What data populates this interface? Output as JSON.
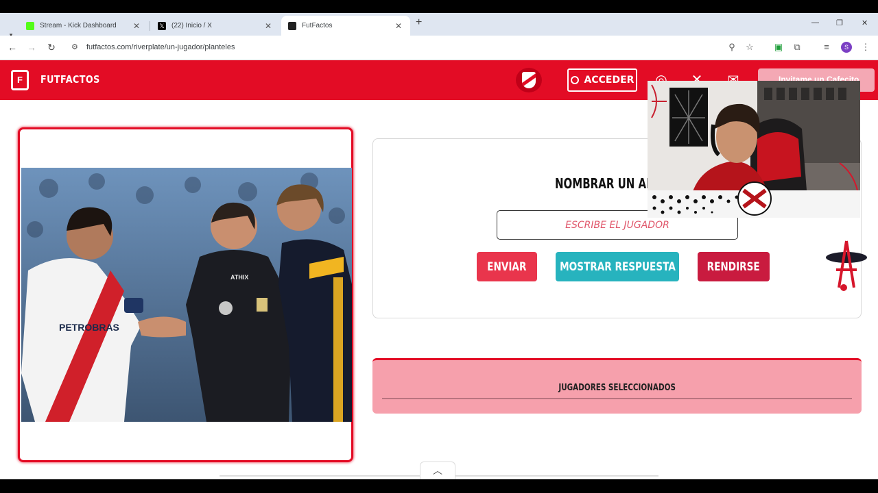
{
  "browser": {
    "tabs": [
      {
        "title": "Stream - Kick Dashboard",
        "favicon": "kick-icon",
        "color": "#53fc18",
        "active": false
      },
      {
        "title": "(22) Inicio / X",
        "favicon": "x-icon",
        "color": "#000000",
        "active": false
      },
      {
        "title": "FutFactos",
        "favicon": "futfactos-icon",
        "color": "#222222",
        "active": true
      }
    ],
    "url": "futfactos.com/riverplate/un-jugador/planteles",
    "profile_initial": "S"
  },
  "site": {
    "brand": "FUTFACTOS",
    "login_label": "ACCEDER",
    "donate_label": "Invitame un Cafecito",
    "accent": "#e30c25"
  },
  "quiz": {
    "question": "NOMBRAR UN ARQ",
    "input_placeholder": "ESCRIBE EL JUGADOR",
    "send_label": "ENVIAR",
    "show_answer_label": "MOSTRAR RESPUESTA",
    "give_up_label": "RENDIRSE",
    "selected_title": "JUGADORES SELECCIONADOS"
  },
  "photo": {
    "sponsor_text": "PETROBRAS",
    "referee_brand": "ATHIX"
  }
}
